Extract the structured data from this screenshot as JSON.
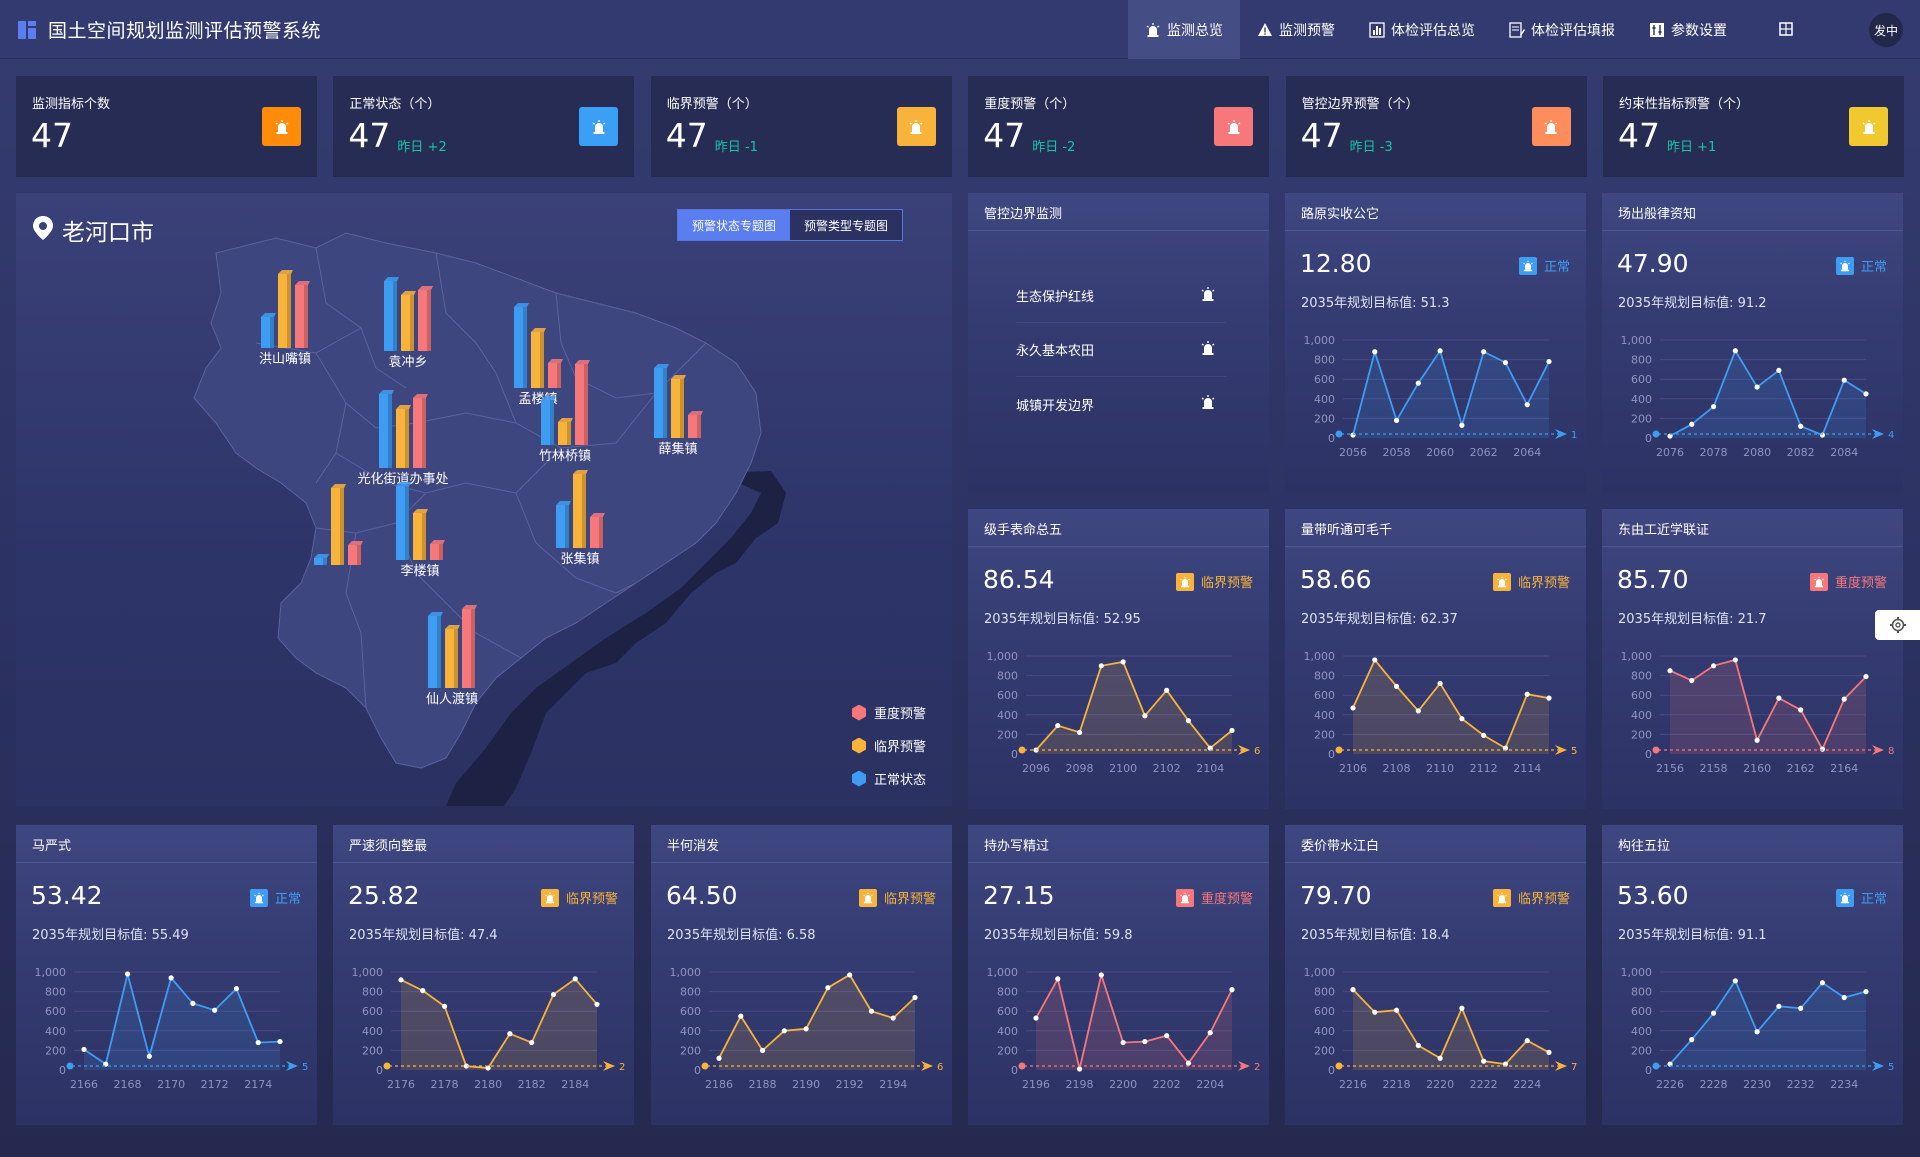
{
  "header": {
    "title": "国土空间规划监测评估预警系统",
    "nav": [
      {
        "label": "监测总览",
        "icon": "alarm-icon",
        "active": true
      },
      {
        "label": "监测预警",
        "icon": "warning-icon",
        "active": false
      },
      {
        "label": "体检评估总览",
        "icon": "bar-chart-icon",
        "active": false
      },
      {
        "label": "体检评估填报",
        "icon": "form-icon",
        "active": false
      },
      {
        "label": "参数设置",
        "icon": "sliders-icon",
        "active": false
      }
    ],
    "user": "发中"
  },
  "colors": {
    "normal": "#3e9df3",
    "critical": "#f8b33a",
    "severe": "#f6787a",
    "accent": "#5a7ef0",
    "delta": "#19c3a6"
  },
  "stats": [
    {
      "label": "监测指标个数",
      "value": "47",
      "delta_prefix": "",
      "delta": "",
      "badge_color": "#ff8b0a"
    },
    {
      "label": "正常状态（个）",
      "value": "47",
      "delta_prefix": "昨日",
      "delta": "+2",
      "badge_color": "#3b9ff5"
    },
    {
      "label": "临界预警（个）",
      "value": "47",
      "delta_prefix": "昨日",
      "delta": "-1",
      "badge_color": "#f8b33a"
    },
    {
      "label": "重度预警（个）",
      "value": "47",
      "delta_prefix": "昨日",
      "delta": "-2",
      "badge_color": "#f6787a"
    },
    {
      "label": "管控边界预警（个）",
      "value": "47",
      "delta_prefix": "昨日",
      "delta": "-3",
      "badge_color": "#fd8d5a"
    },
    {
      "label": "约束性指标预警（个）",
      "value": "47",
      "delta_prefix": "昨日",
      "delta": "+1",
      "badge_color": "#f1c92f"
    }
  ],
  "map": {
    "title": "老河口市",
    "toggle": [
      "预警状态专题图",
      "预警类型专题图"
    ],
    "legend": [
      {
        "label": "重度预警",
        "color": "#f6787a"
      },
      {
        "label": "临界预警",
        "color": "#f8b33a"
      },
      {
        "label": "正常状态",
        "color": "#3e9df3"
      }
    ],
    "towns": [
      {
        "name": "洪山嘴镇",
        "values": [
          0.35,
          0.82,
          0.7
        ]
      },
      {
        "name": "袁冲乡",
        "values": [
          0.78,
          0.62,
          0.68
        ]
      },
      {
        "name": "孟楼镇",
        "values": [
          0.9,
          0.62,
          0.28
        ]
      },
      {
        "name": "薛集镇",
        "values": [
          0.78,
          0.65,
          0.25
        ]
      },
      {
        "name": "光化街道办事处",
        "values": [
          0.82,
          0.65,
          0.78
        ]
      },
      {
        "name": "竹林桥镇",
        "values": [
          0.5,
          0.25,
          0.9
        ]
      },
      {
        "name": "李楼镇",
        "values": [
          0.82,
          0.52,
          0.18
        ]
      },
      {
        "name": "张集镇",
        "values": [
          0.48,
          0.82,
          0.35
        ]
      },
      {
        "name": "仙人渡镇",
        "values": [
          0.8,
          0.65,
          0.88
        ]
      },
      {
        "name": "",
        "values": [
          0.08,
          0.85,
          0.22
        ]
      }
    ]
  },
  "boundary": {
    "title": "管控边界监测",
    "items": [
      "生态保护红线",
      "永久基本农田",
      "城镇开发边界"
    ]
  },
  "cards": [
    {
      "title": "路原实收公它",
      "value": "12.80",
      "status": "正常",
      "level": "normal",
      "target_label": "2035年规划目标值:",
      "target": "51.3",
      "years": [
        "2056",
        "2058",
        "2060",
        "2062",
        "2064"
      ],
      "end": "1",
      "values": [
        30,
        880,
        180,
        560,
        890,
        130,
        880,
        770,
        340,
        780
      ]
    },
    {
      "title": "场出般律资知",
      "value": "47.90",
      "status": "正常",
      "level": "normal",
      "target_label": "2035年规划目标值:",
      "target": "91.2",
      "years": [
        "2076",
        "2078",
        "2080",
        "2082",
        "2084"
      ],
      "end": "4",
      "values": [
        20,
        140,
        320,
        890,
        520,
        690,
        120,
        30,
        590,
        450
      ]
    },
    {
      "title": "级手表命总五",
      "value": "86.54",
      "status": "临界预警",
      "level": "critical",
      "target_label": "2035年规划目标值:",
      "target": "52.95",
      "years": [
        "2096",
        "2098",
        "2100",
        "2102",
        "2104"
      ],
      "end": "6",
      "values": [
        40,
        290,
        220,
        900,
        940,
        390,
        650,
        340,
        60,
        240
      ]
    },
    {
      "title": "量带听通可毛千",
      "value": "58.66",
      "status": "临界预警",
      "level": "critical",
      "target_label": "2035年规划目标值:",
      "target": "62.37",
      "years": [
        "2106",
        "2108",
        "2110",
        "2112",
        "2114"
      ],
      "end": "5",
      "values": [
        470,
        960,
        690,
        440,
        720,
        360,
        190,
        60,
        610,
        570
      ]
    },
    {
      "title": "东由工近学联证",
      "value": "85.70",
      "status": "重度预警",
      "level": "severe",
      "target_label": "2035年规划目标值:",
      "target": "21.7",
      "years": [
        "2156",
        "2158",
        "2160",
        "2162",
        "2164"
      ],
      "end": "8",
      "values": [
        850,
        750,
        900,
        960,
        140,
        570,
        450,
        50,
        560,
        790
      ]
    },
    {
      "title": "马严式",
      "value": "53.42",
      "status": "正常",
      "level": "normal",
      "target_label": "2035年规划目标值:",
      "target": "55.49",
      "years": [
        "2166",
        "2168",
        "2170",
        "2172",
        "2174"
      ],
      "end": "5",
      "values": [
        210,
        60,
        980,
        140,
        940,
        680,
        610,
        830,
        280,
        290
      ]
    },
    {
      "title": "严速须向整最",
      "value": "25.82",
      "status": "临界预警",
      "level": "critical",
      "target_label": "2035年规划目标值:",
      "target": "47.4",
      "years": [
        "2176",
        "2178",
        "2180",
        "2182",
        "2184"
      ],
      "end": "2",
      "values": [
        920,
        810,
        650,
        40,
        20,
        370,
        280,
        770,
        930,
        670
      ]
    },
    {
      "title": "半何消发",
      "value": "64.50",
      "status": "临界预警",
      "level": "critical",
      "target_label": "2035年规划目标值:",
      "target": "6.58",
      "years": [
        "2186",
        "2188",
        "2190",
        "2192",
        "2194"
      ],
      "end": "6",
      "values": [
        120,
        550,
        200,
        400,
        420,
        840,
        970,
        600,
        530,
        740
      ]
    },
    {
      "title": "持办写精过",
      "value": "27.15",
      "status": "重度预警",
      "level": "severe",
      "target_label": "2035年规划目标值:",
      "target": "59.8",
      "years": [
        "2196",
        "2198",
        "2200",
        "2202",
        "2204"
      ],
      "end": "2",
      "values": [
        530,
        930,
        10,
        970,
        280,
        290,
        350,
        70,
        380,
        820
      ]
    },
    {
      "title": "委价带水江白",
      "value": "79.70",
      "status": "临界预警",
      "level": "critical",
      "target_label": "2035年规划目标值:",
      "target": "18.4",
      "years": [
        "2216",
        "2218",
        "2220",
        "2222",
        "2224"
      ],
      "end": "7",
      "values": [
        820,
        590,
        610,
        250,
        120,
        630,
        90,
        60,
        300,
        180
      ]
    },
    {
      "title": "构往五拉",
      "value": "53.60",
      "status": "正常",
      "level": "normal",
      "target_label": "2035年规划目标值:",
      "target": "91.1",
      "years": [
        "2226",
        "2228",
        "2230",
        "2232",
        "2234"
      ],
      "end": "5",
      "values": [
        60,
        310,
        580,
        910,
        390,
        650,
        630,
        890,
        740,
        800
      ]
    }
  ],
  "y_ticks": [
    "0",
    "200",
    "400",
    "600",
    "800",
    "1,000"
  ]
}
